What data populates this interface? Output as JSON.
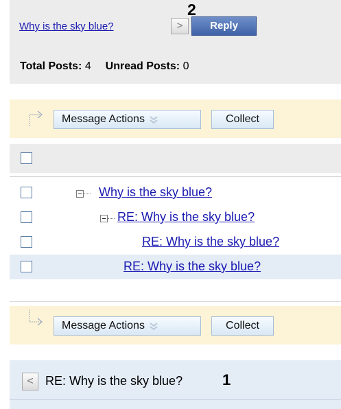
{
  "header": {
    "thread_link": "Why is the sky blue?",
    "next_glyph": ">",
    "callout": "2",
    "reply_label": "Reply",
    "total_posts_label": "Total Posts:",
    "total_posts_value": "4",
    "unread_posts_label": "Unread Posts:",
    "unread_posts_value": "0"
  },
  "action_bar_top": {
    "message_actions_label": "Message Actions",
    "collect_label": "Collect"
  },
  "thread_tree": {
    "items": [
      {
        "label": "Why is the sky blue?",
        "level": 0,
        "expandable": true
      },
      {
        "label": "RE: Why is the sky blue?",
        "level": 1,
        "expandable": true
      },
      {
        "label": "RE: Why is the sky blue?",
        "level": 2,
        "expandable": false
      },
      {
        "label": "RE: Why is the sky blue?",
        "level": 1,
        "expandable": false,
        "highlighted": true
      }
    ]
  },
  "action_bar_bottom": {
    "message_actions_label": "Message Actions",
    "collect_label": "Collect"
  },
  "footer_nav": {
    "prev_glyph": "<",
    "current_title": "RE: Why is the sky blue?",
    "callout": "1"
  },
  "colors": {
    "link": "#1a1ab2",
    "reply_button": "#4a6db2",
    "action_bar_bg": "#fdf3d6",
    "highlight_row": "#e4ecf6",
    "header_bg": "#ececec"
  }
}
